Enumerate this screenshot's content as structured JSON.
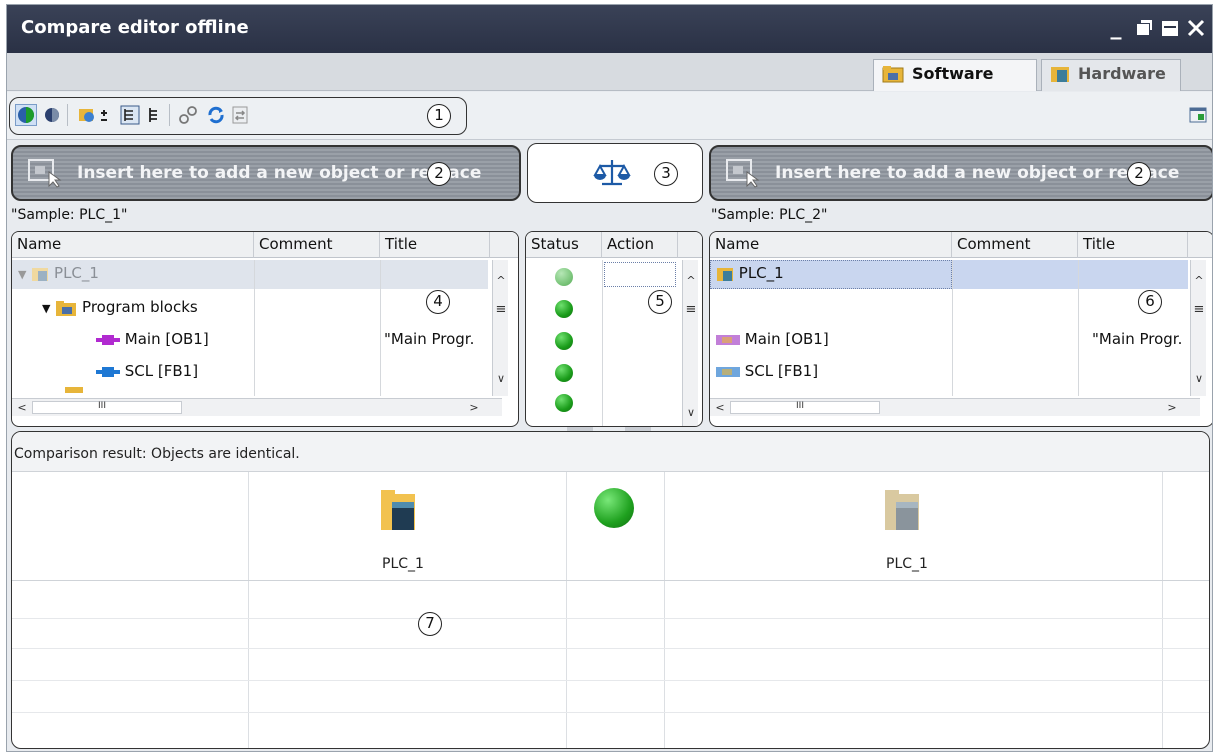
{
  "window": {
    "title": "Compare editor offline"
  },
  "tabs": [
    {
      "label": "Software",
      "icon": "software-folder-icon",
      "active": true
    },
    {
      "label": "Hardware",
      "icon": "hardware-device-icon",
      "active": false
    }
  ],
  "callouts": {
    "toolbar": "1",
    "insert": "2",
    "compare": "3",
    "left_tree": "4",
    "status_action": "5",
    "right_tree": "6",
    "result": "7"
  },
  "left": {
    "insert_text": "Insert here to add a new object or replace",
    "sample_label": "\"Sample: PLC_1\"",
    "columns": [
      "Name",
      "Comment",
      "Title"
    ],
    "rows": [
      {
        "name": "PLC_1",
        "comment": "",
        "title": ""
      },
      {
        "name": "Program blocks",
        "comment": "",
        "title": ""
      },
      {
        "name": "Main [OB1]",
        "comment": "",
        "title": "\"Main Progr."
      },
      {
        "name": "SCL [FB1]",
        "comment": "",
        "title": ""
      }
    ],
    "hscroll_mark": "III"
  },
  "center": {
    "columns": [
      "Status",
      "Action"
    ]
  },
  "right": {
    "insert_text": "Insert here to add a new object or replace",
    "sample_label": "\"Sample: PLC_2\"",
    "columns": [
      "Name",
      "Comment",
      "Title"
    ],
    "rows": [
      {
        "name": "PLC_1",
        "comment": "",
        "title": ""
      },
      {
        "name": "",
        "comment": "",
        "title": ""
      },
      {
        "name": "Main [OB1]",
        "comment": "",
        "title": "\"Main Progr."
      },
      {
        "name": "SCL [FB1]",
        "comment": "",
        "title": ""
      }
    ],
    "hscroll_mark": "III"
  },
  "result": {
    "message": "Comparison result: Objects are identical.",
    "left_object": "PLC_1",
    "right_object": "PLC_1"
  },
  "colors": {
    "title_bar": "#2f3649",
    "status_green": "#1a9c1a",
    "selection": "#c9d6ef"
  }
}
